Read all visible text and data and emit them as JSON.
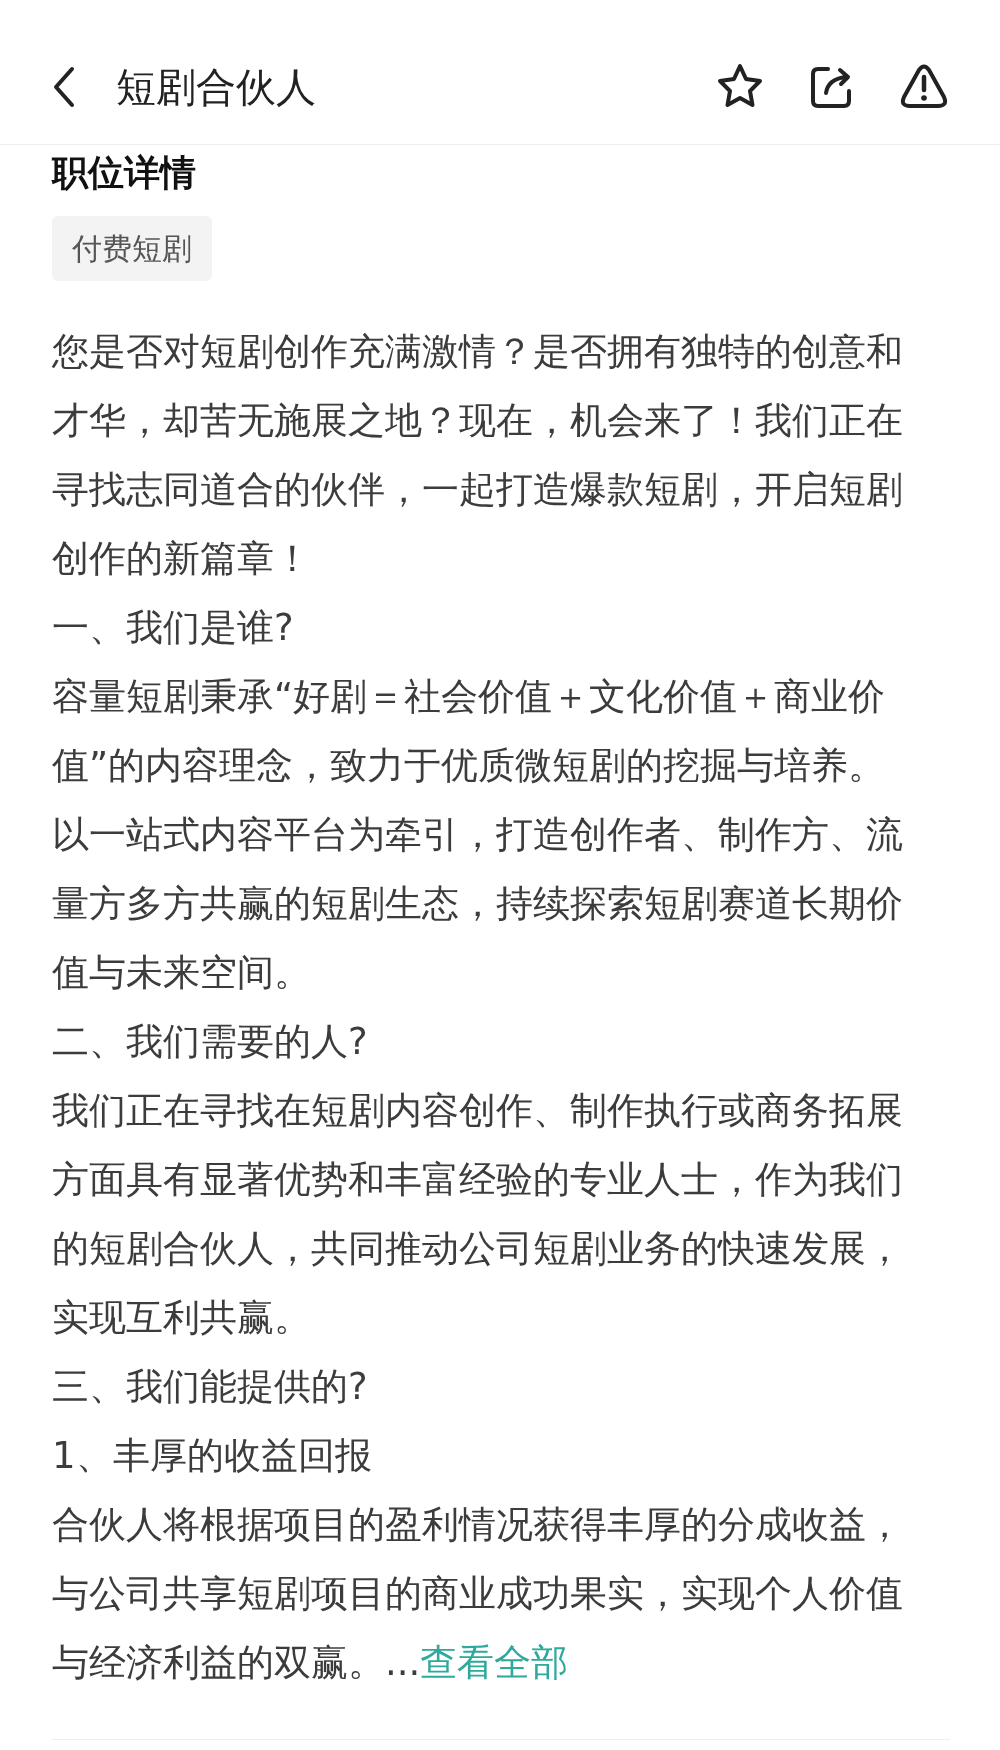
{
  "header": {
    "title": "短剧合伙人"
  },
  "section_title": "职位详情",
  "tags": [
    "付费短剧"
  ],
  "description": [
    {
      "kind": "paragraph",
      "text": "您是否对短剧创作充满激情？是否拥有独特的创意和才华，却苦无施展之地？现在，机会来了！我们正在寻找志同道合的伙伴，一起打造爆款短剧，开启短剧创作的新篇章！"
    },
    {
      "kind": "paragraph",
      "text": "一、我们是谁?"
    },
    {
      "kind": "paragraph",
      "text": "容量短剧秉承“好剧＝社会价值＋文化价值＋商业价值”的内容理念，致力于优质微短剧的挖掘与培养。以一站式内容平台为牵引，打造创作者、制作方、流量方多方共赢的短剧生态，持续探索短剧赛道长期价值与未来空间。"
    },
    {
      "kind": "paragraph",
      "text": "二、我们需要的人?"
    },
    {
      "kind": "paragraph",
      "text": "我们正在寻找在短剧内容创作、制作执行或商务拓展方面具有显著优势和丰富经验的专业人士，作为我们的短剧合伙人，共同推动公司短剧业务的快速发展，实现互利共赢。"
    },
    {
      "kind": "paragraph",
      "text": "三、我们能提供的?"
    },
    {
      "kind": "paragraph",
      "text": "1、丰厚的收益回报"
    },
    {
      "kind": "truncated",
      "text": "合伙人将根据项目的盈利情况获得丰厚的分成收益，与公司共享短剧项目的商业成功果实，实现个人价值与经济利益的双赢。...",
      "link": "查看全部"
    }
  ]
}
